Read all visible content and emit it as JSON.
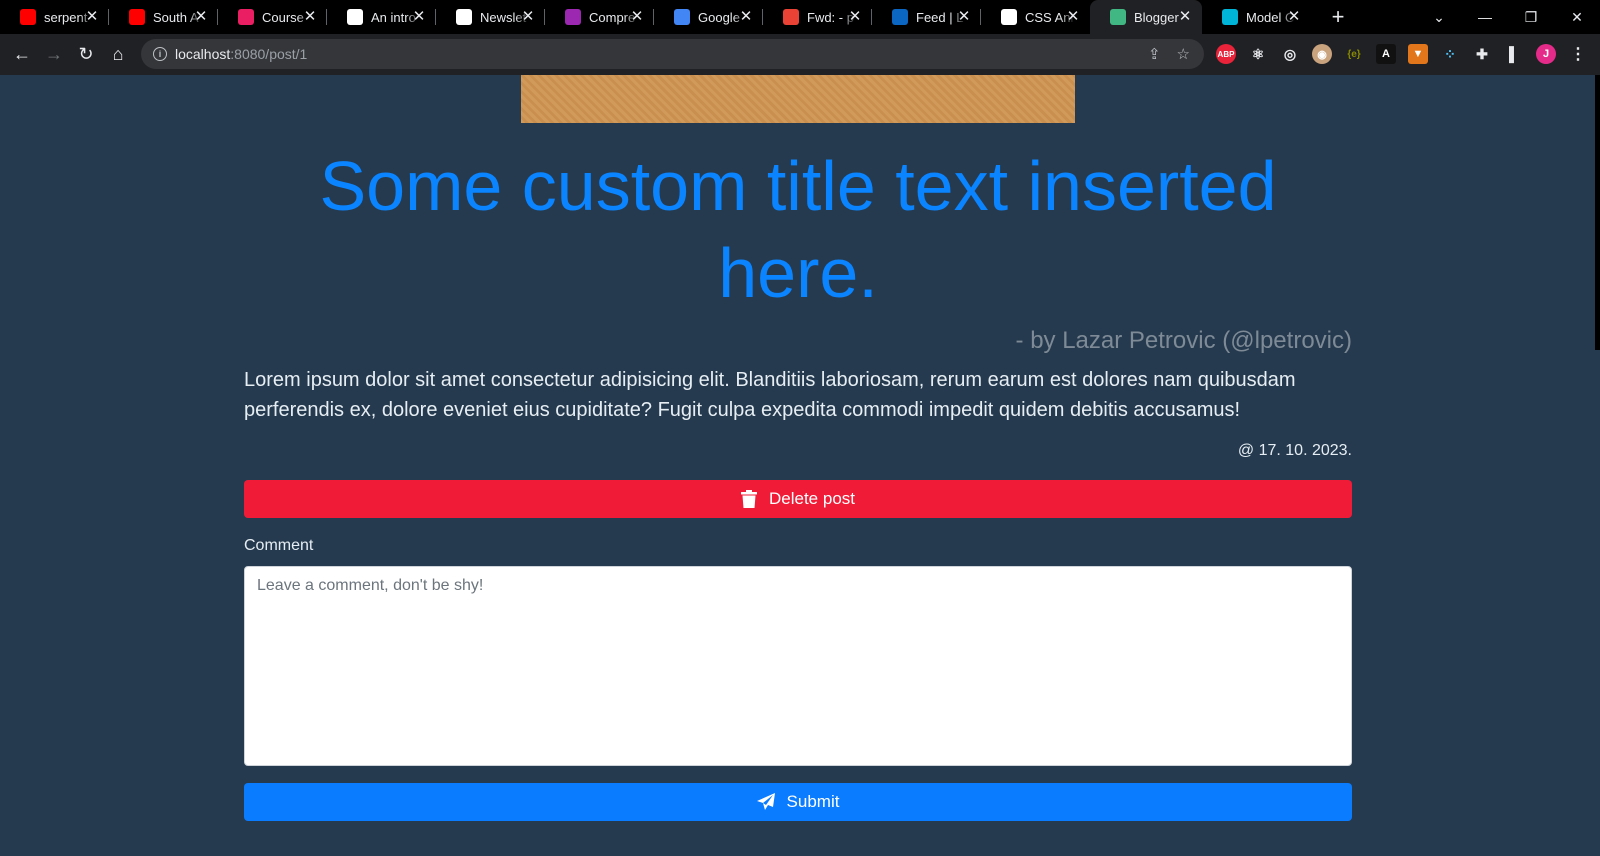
{
  "browser": {
    "tabs": [
      {
        "label": "serpent",
        "icon": "youtube-icon",
        "color": "#ff0000"
      },
      {
        "label": "South A",
        "icon": "youtube-icon",
        "color": "#ff0000"
      },
      {
        "label": "Course",
        "icon": "course-icon",
        "color": "#e91e63"
      },
      {
        "label": "An intro",
        "icon": "nr-icon",
        "color": "#ffffff"
      },
      {
        "label": "Newslet",
        "icon": "newsletter-icon",
        "color": "#ffffff"
      },
      {
        "label": "Compre",
        "icon": "compress-icon",
        "color": "#9c27b0"
      },
      {
        "label": "Google",
        "icon": "google-translate-icon",
        "color": "#4285f4"
      },
      {
        "label": "Fwd: - p",
        "icon": "gmail-icon",
        "color": "#ea4335"
      },
      {
        "label": "Feed | L",
        "icon": "linkedin-icon",
        "color": "#0a66c2"
      },
      {
        "label": "CSS Ani",
        "icon": "codepen-icon",
        "color": "#ffffff"
      },
      {
        "label": "Blogger",
        "icon": "vue-icon",
        "color": "#41b883"
      },
      {
        "label": "Model C",
        "icon": "cube-icon",
        "color": "#00b4d8"
      }
    ],
    "close_glyph": "✕",
    "new_tab_glyph": "+",
    "url_host": "localhost",
    "url_rest": ":8080/post/1",
    "profile_initial": "J"
  },
  "post": {
    "title": "Some custom title text inserted here.",
    "author": "- by Lazar Petrovic (@lpetrovic)",
    "body": "Lorem ipsum dolor sit amet consectetur adipisicing elit. Blanditiis laboriosam, rerum earum est dolores nam quibusdam perferendis ex, dolore eveniet eius cupiditate? Fugit culpa expedita commodi impedit quidem debitis accusamus!",
    "date": "@ 17. 10. 2023.",
    "delete_label": "Delete post"
  },
  "comment": {
    "label": "Comment",
    "placeholder": "Leave a comment, don't be shy!",
    "submit_label": "Submit"
  },
  "colors": {
    "page_bg": "#253a4e",
    "title": "#0a84ff",
    "danger": "#f01c37",
    "primary": "#0a7cff"
  }
}
